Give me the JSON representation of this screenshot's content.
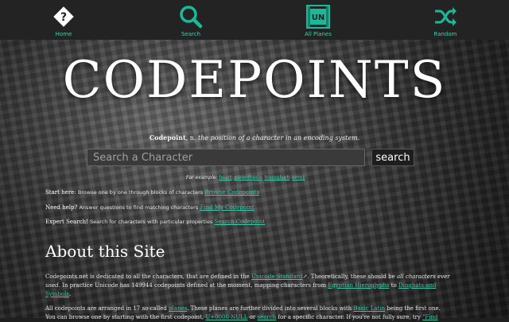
{
  "nav": {
    "items": [
      {
        "label": "Home",
        "icon": "question-diamond-icon"
      },
      {
        "label": "Search",
        "icon": "magnifier-icon"
      },
      {
        "label": "All Planes",
        "icon": "unicode-planes-icon"
      },
      {
        "label": "Random",
        "icon": "shuffle-icon"
      }
    ]
  },
  "hero": {
    "title": "CODEPOINTS",
    "tagline_term": "Codepoint",
    "tagline_pos": ", n.",
    "tagline_def": "the position of a character in an encoding system."
  },
  "search": {
    "placeholder": "Search a Character",
    "button": "search",
    "examples_label": "For example:",
    "examples": [
      "heart",
      "parenthesis",
      "hieroglyph",
      "emoji"
    ]
  },
  "help": [
    {
      "lead": "Start here:",
      "desc": "Browse one by one through blocks of characters",
      "link": "Browse Codepoints"
    },
    {
      "lead": "Need help?",
      "desc": "Answer questions to find matching characters",
      "link": "Find My Codepoint"
    },
    {
      "lead": "Expert Search!",
      "desc": "Search for characters with particular properties",
      "link": "Search Codepoint"
    }
  ],
  "about": {
    "title": "About this Site",
    "p1": {
      "a": "Codepoints.net is dedicated to all the characters, that are defined in the",
      "link1": "Unicode Standard",
      "b": ". Theoretically, these should be",
      "c": "all characters ever used",
      "d": ". In practice Unicode has 149944 codepoints defined at the moment, mapping characters from",
      "link2": "Egyptian Hieroglyphs",
      "e": "to",
      "link3": "Dingbats and Symbols",
      "f": "."
    },
    "p2": {
      "a": "All codepoints are arranged in 17 so-called",
      "link1": "planes",
      "b": ". These planes are further divided into several blocks with",
      "link2": "Basic Latin",
      "c": "being the first one."
    },
    "p3": {
      "a": "You can browse one by starting with the first codepoint,",
      "link1": "U+0000 NULL",
      "b": "or",
      "link2": "search",
      "c": "for a specific character. If you're not fully sure, try",
      "link3": "\"Find"
    }
  },
  "colors": {
    "accent": "#1ab99a",
    "link": "#3fc9a8",
    "nav_bg": "#232323"
  }
}
